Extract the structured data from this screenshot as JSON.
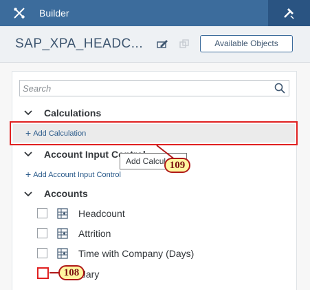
{
  "topbar": {
    "title": "Builder",
    "tools_icon": "tools-icon",
    "builder_icon": "hammer-icon",
    "color": "#3c6c9c"
  },
  "header": {
    "model_title": "SAP_XPA_HEADC...",
    "edit_icon": "edit-icon",
    "copy_icon": "copy-icon",
    "available_objects_label": "Available Objects"
  },
  "search": {
    "placeholder": "Search",
    "icon": "search-icon"
  },
  "calculations": {
    "heading": "Calculations",
    "add_label": "Add Calculation"
  },
  "tooltip": {
    "text": "Add Calculation"
  },
  "account_input_control": {
    "heading": "Account Input Control",
    "add_label": "Add Account Input Control"
  },
  "accounts": {
    "heading": "Accounts",
    "items": [
      {
        "label": "Headcount",
        "checked": false
      },
      {
        "label": "Attrition",
        "checked": false
      },
      {
        "label": "Time with Company (Days)",
        "checked": false
      }
    ],
    "partial_item_label": "alary"
  },
  "annotations": {
    "step_a": "109",
    "step_b": "108",
    "highlight_color": "#e02020",
    "badge_color": "#fff7a0"
  }
}
